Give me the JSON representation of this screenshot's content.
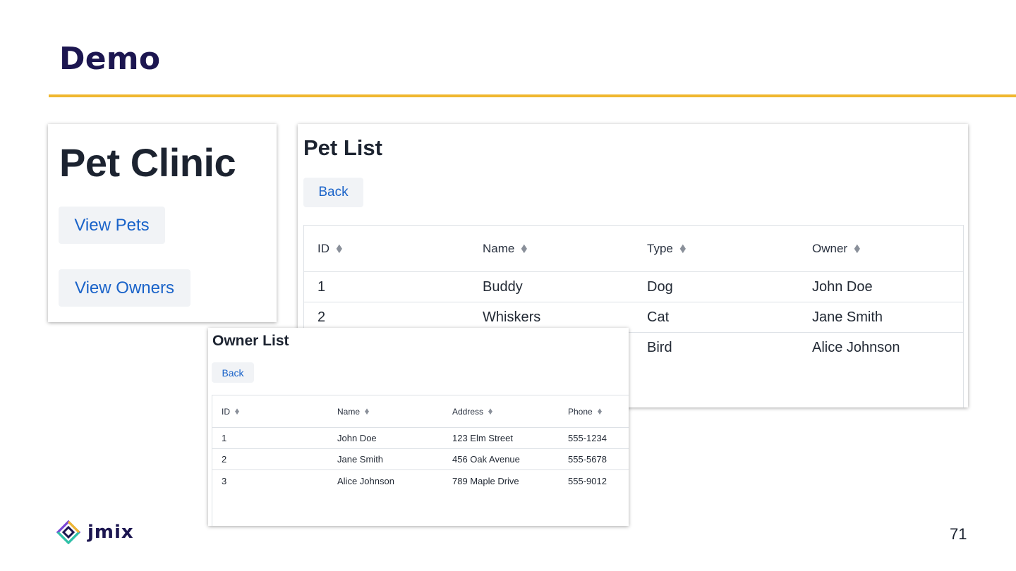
{
  "slide": {
    "title": "Demo",
    "page_number": "71",
    "brand": "jmix"
  },
  "pet_clinic": {
    "title": "Pet Clinic",
    "view_pets_label": "View Pets",
    "view_owners_label": "View Owners"
  },
  "pet_list": {
    "title": "Pet List",
    "back_label": "Back",
    "columns": [
      "ID",
      "Name",
      "Type",
      "Owner"
    ],
    "rows": [
      [
        "1",
        "Buddy",
        "Dog",
        "John Doe"
      ],
      [
        "2",
        "Whiskers",
        "Cat",
        "Jane Smith"
      ],
      [
        "",
        "",
        "Bird",
        "Alice Johnson"
      ]
    ]
  },
  "owner_list": {
    "title": "Owner List",
    "back_label": "Back",
    "columns": [
      "ID",
      "Name",
      "Address",
      "Phone"
    ],
    "rows": [
      [
        "1",
        "John Doe",
        "123 Elm Street",
        "555-1234"
      ],
      [
        "2",
        "Jane Smith",
        "456 Oak Avenue",
        "555-5678"
      ],
      [
        "3",
        "Alice Johnson",
        "789 Maple Drive",
        "555-9012"
      ]
    ]
  },
  "colors": {
    "title": "#1c1650",
    "rule": "#f0b72f",
    "link": "#1a63c9"
  },
  "icons": {
    "sort": "sort-icon",
    "logo": "jmix-logo-icon"
  }
}
